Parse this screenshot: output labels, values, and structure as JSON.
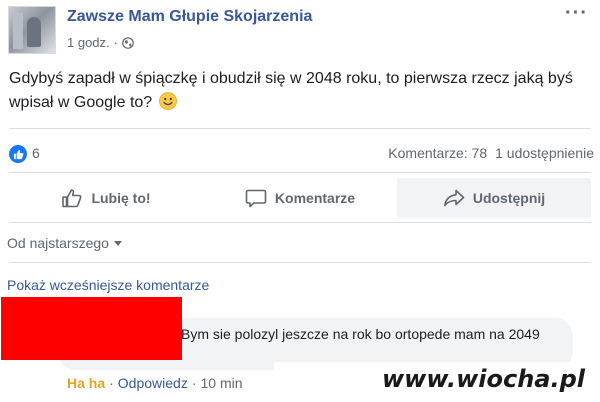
{
  "post": {
    "page_name": "Zawsze Mam Głupie Skojarzenia",
    "timestamp": "1 godz.",
    "separator": "·",
    "text": "Gdybyś zapadł w śpiączkę i obudził się w 2048 roku, to pierwsza rzecz jaką byś wpisał w Google to?",
    "emoji": "slightly-smiling-face",
    "more_menu": "···"
  },
  "stats": {
    "reaction_count": "6",
    "comments": "Komentarze: 78",
    "shares": "1 udostępnienie"
  },
  "actions": {
    "like": "Lubię to!",
    "comment": "Komentarze",
    "share": "Udostępnij"
  },
  "comments": {
    "sort_label": "Od najstarszego",
    "view_previous": "Pokaż wcześniejsze komentarze",
    "items": [
      {
        "text": "Bym sie polozyl jeszcze na rok bo ortopede mam na 2049",
        "reaction": "Ha ha",
        "separator": "·",
        "reply": "Odpowiedz",
        "time": "10 min"
      }
    ]
  },
  "watermark": "www.wiocha.pl",
  "colors": {
    "link_blue": "#385898",
    "fb_blue": "#1877f2",
    "meta_gray": "#606770",
    "haha_yellow": "#e0a526",
    "censor_red": "#ff0000"
  },
  "icons": {
    "privacy": "globe-icon",
    "like_badge": "thumbs-up-icon",
    "like_action": "thumbs-up-outline-icon",
    "comment_action": "speech-bubble-icon",
    "share_action": "share-arrow-icon"
  }
}
